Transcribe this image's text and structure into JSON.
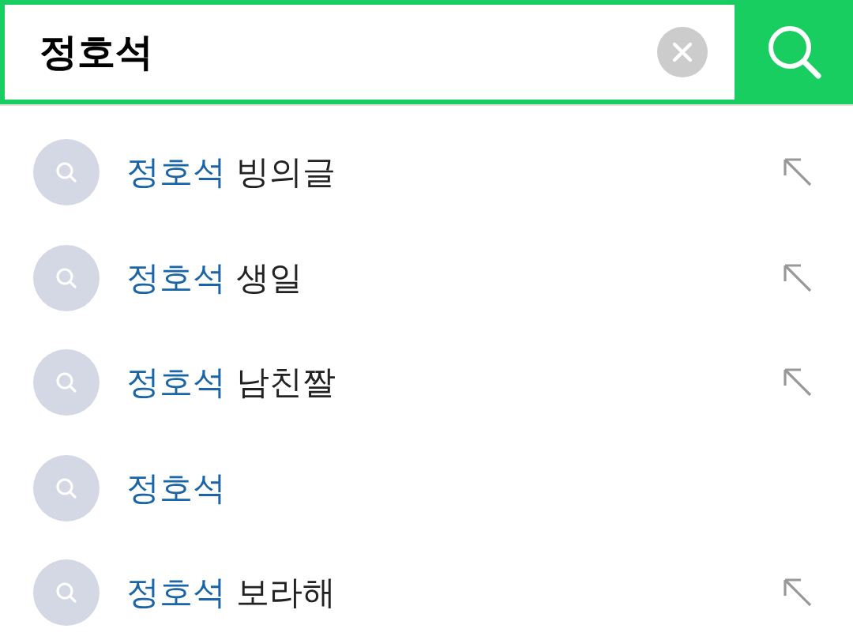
{
  "search": {
    "value": "정호석"
  },
  "suggestions": [
    {
      "match": "정호석",
      "rest": "빙의글",
      "arrow": true
    },
    {
      "match": "정호석",
      "rest": "생일",
      "arrow": true
    },
    {
      "match": "정호석",
      "rest": "남친짤",
      "arrow": true
    },
    {
      "match": "정호석",
      "arrow": false
    },
    {
      "match": "정호석",
      "rest": "보라해",
      "arrow": true
    }
  ]
}
